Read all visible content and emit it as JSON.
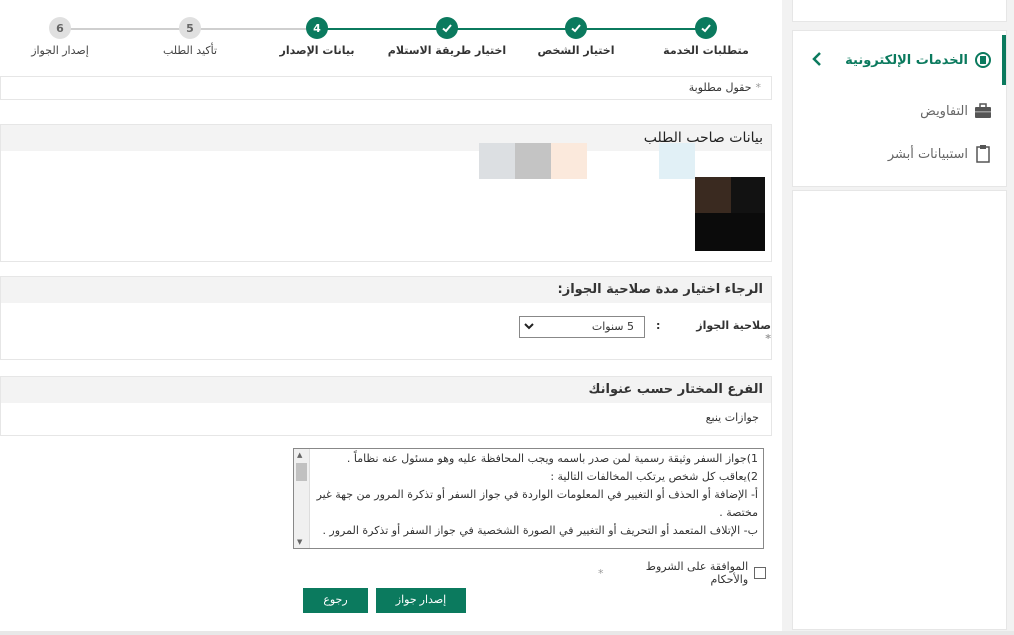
{
  "sidebar": {
    "items": [
      {
        "label": "الخدمات الإلكترونية",
        "icon": "eservices-icon",
        "active": true
      },
      {
        "label": "التفاويض",
        "icon": "briefcase-icon",
        "active": false
      },
      {
        "label": "استبيانات أبشر",
        "icon": "clipboard-icon",
        "active": false
      }
    ]
  },
  "stepper": {
    "steps": [
      {
        "label": "متطلبات الخدمة",
        "state": "done",
        "num": ""
      },
      {
        "label": "اختيار الشخص",
        "state": "done",
        "num": ""
      },
      {
        "label": "اختيار طريقة الاستلام",
        "state": "done",
        "num": ""
      },
      {
        "label": "بيانات الإصدار",
        "state": "current",
        "num": "4"
      },
      {
        "label": "تأكيد الطلب",
        "state": "todo",
        "num": "5"
      },
      {
        "label": "إصدار الجواز",
        "state": "todo",
        "num": "6"
      }
    ]
  },
  "form": {
    "required_note": "حقول مطلوبة",
    "applicant_title": "بيانات صاحب الطلب",
    "validity_title": "الرجاء اختيار مدة صلاحية الجواز:",
    "validity_label": "صلاحية الجواز",
    "validity_value": "5 سنوات",
    "branch_title": "الفرع المختار حسب عنوانك",
    "branch_value": "جوازات ينبع",
    "terms": [
      "1)جواز السفر وثيقة رسمية لمن صدر باسمه ويجب المحافظة عليه وهو مسئول عنه نظاماً .",
      "2)يعاقب كل شخص يرتكب المخالفات التالية :",
      "أ- الإضافة أو الحذف أو التغيير في المعلومات الواردة في جواز السفر أو تذكرة المرور من جهة غير مختصة .",
      "ب- الإتلاف المتعمد أو التحريف أو التغيير في الصورة الشخصية في جواز السفر أو تذكرة المرور ."
    ],
    "agree_label": "الموافقة على الشروط والأحكام"
  },
  "buttons": {
    "issue": "إصدار جواز",
    "back": "رجوع"
  },
  "colors": {
    "primary": "#0b7a5e"
  }
}
